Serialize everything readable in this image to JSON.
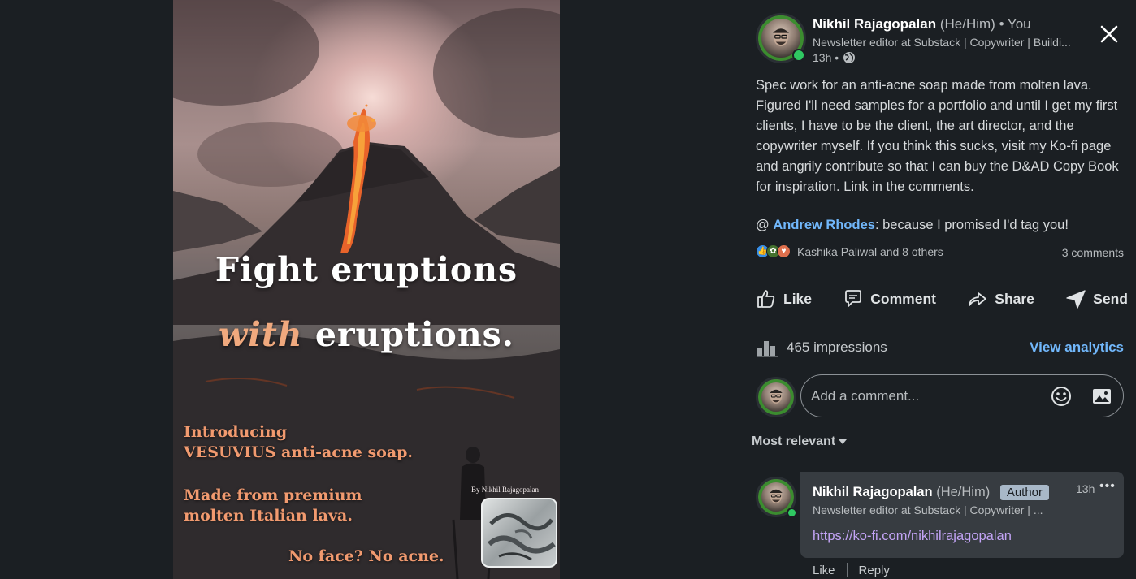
{
  "poster": {
    "headline_line1": "Fight eruptions",
    "headline_accent": "with",
    "headline_line2_rest": " eruptions.",
    "copy1_line1": "Introducing",
    "copy1_line2": "VESUVIUS anti-acne soap.",
    "copy2_line1": "Made from premium",
    "copy2_line2": "molten Italian lava.",
    "tagline": "No face? No acne.",
    "byline": "By Nikhil Rajagopalan"
  },
  "post": {
    "author_name": "Nikhil Rajagopalan",
    "author_pronouns": "(He/Him)",
    "author_relation": "• You",
    "author_headline": "Newsletter editor at Substack | Copywriter | Buildi...",
    "time": "13h •",
    "body": "Spec work for an anti-acne soap made from molten lava. Figured I'll need samples for a portfolio and until I get my first clients, I have to be the client, the art director, and the copywriter myself. If you think this sucks, visit my Ko-fi page and angrily contribute so that I can buy the D&AD Copy Book for inspiration. Link in the comments.",
    "mention_prefix": "@ ",
    "mention_name": "Andrew Rhodes",
    "mention_suffix": ": because I promised I'd tag you!",
    "reactions_text": "Kashika Paliwal and 8 others",
    "comments_count": "3 comments"
  },
  "actions": {
    "like": "Like",
    "comment": "Comment",
    "share": "Share",
    "send": "Send"
  },
  "analytics": {
    "impressions": "465 impressions",
    "view_analytics": "View analytics"
  },
  "comment_input": {
    "placeholder": "Add a comment..."
  },
  "sort": {
    "label": "Most relevant"
  },
  "comment": {
    "author_name": "Nikhil Rajagopalan",
    "author_pronouns": "(He/Him)",
    "badge": "Author",
    "time": "13h",
    "more": "•••",
    "headline": "Newsletter editor at Substack | Copywriter | ...",
    "link": "https://ko-fi.com/nikhilrajagopalan",
    "like": "Like",
    "reply": "Reply"
  },
  "colors": {
    "background": "#1b1f23",
    "link_blue": "#71b7fb",
    "link_purple": "#c3a4f6",
    "poster_accent": "#f19a6f",
    "presence_green": "#2fc862"
  },
  "icons": [
    "close-icon",
    "globe-icon",
    "like-icon",
    "comment-icon",
    "share-icon",
    "send-icon",
    "bar-chart-icon",
    "emoji-icon",
    "image-icon",
    "chevron-down-icon"
  ]
}
